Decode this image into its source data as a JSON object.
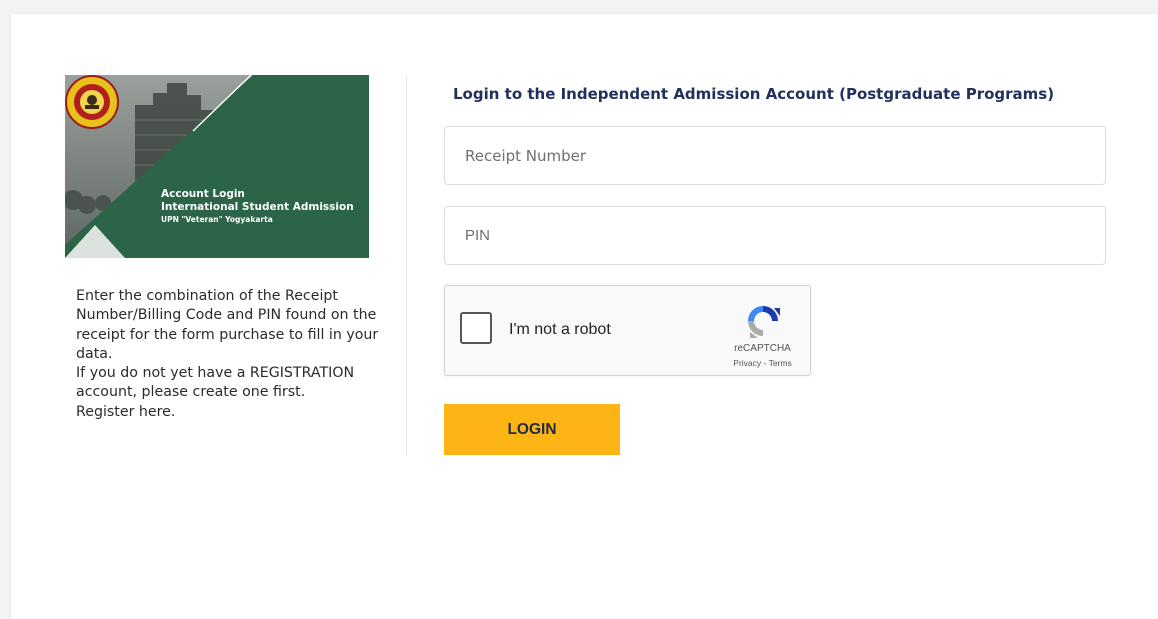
{
  "banner": {
    "line1": "Account Login",
    "line2": "International Student Admission",
    "line3": "UPN \"Veteran\" Yogyakarta",
    "green": "#2c6447"
  },
  "info": {
    "paragraph1": "Enter the combination of the Receipt Number/Billing Code and PIN found on the receipt for the form purchase to fill in your data.",
    "paragraph2": "If you do not yet have a REGISTRATION account, please create one first.",
    "paragraph3": "Register here."
  },
  "form": {
    "title": "Login to the Independent Admission Account (Postgraduate Programs)",
    "receipt_placeholder": "Receipt Number",
    "pin_placeholder": "PIN",
    "login_label": "LOGIN",
    "accent": "#fdb515"
  },
  "captcha": {
    "label": "I'm not a robot",
    "brand": "reCAPTCHA",
    "links": "Privacy - Terms"
  }
}
